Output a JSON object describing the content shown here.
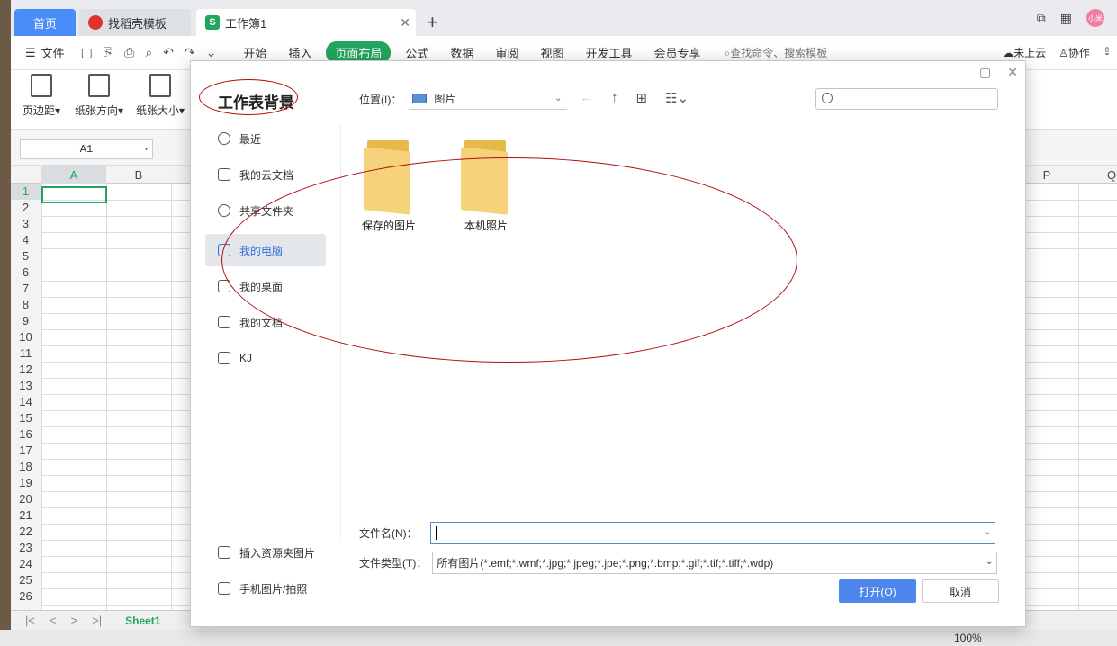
{
  "titlebar": {
    "tab_home": "首页",
    "tab_templates": "找稻壳模板",
    "tab_workbook": "工作簿1",
    "avatar_text": "小米"
  },
  "menubar": {
    "file": "文件",
    "items": [
      "开始",
      "插入",
      "页面布局",
      "公式",
      "数据",
      "审阅",
      "视图",
      "开发工具",
      "会员专享"
    ],
    "search": "查找命令、搜索模板",
    "cloud": "未上云",
    "collab": "协作"
  },
  "ribbon": {
    "margins": "页边距",
    "orientation": "纸张方向",
    "size": "纸张大小"
  },
  "formula": {
    "cell_ref": "A1"
  },
  "sheet": {
    "columns": [
      "A",
      "B",
      "P",
      "Q"
    ],
    "rows": [
      "1",
      "2",
      "3",
      "4",
      "5",
      "6",
      "7",
      "8",
      "9",
      "10",
      "11",
      "12",
      "13",
      "14",
      "15",
      "16",
      "17",
      "18",
      "19",
      "20",
      "21",
      "22",
      "23",
      "24",
      "25",
      "26"
    ],
    "sheet_tab": "Sheet1"
  },
  "status": {
    "zoom": "100%"
  },
  "dialog": {
    "title": "工作表背景",
    "nav": [
      "最近",
      "我的云文档",
      "共享文件夹",
      "我的电脑",
      "我的桌面",
      "我的文档",
      "KJ"
    ],
    "nav_bottom": [
      "插入资源夹图片",
      "手机图片/拍照"
    ],
    "location_label": "位置(I)：",
    "location_value": "图片",
    "folders": [
      "保存的图片",
      "本机照片"
    ],
    "filename_label": "文件名(N)：",
    "filename_value": "",
    "filetype_label": "文件类型(T)：",
    "filetype_value": "所有图片(*.emf;*.wmf;*.jpg;*.jpeg;*.jpe;*.png;*.bmp;*.gif;*.tif;*.tiff;*.wdp)",
    "open_button": "打开(O)",
    "cancel_button": "取消"
  },
  "colors": {
    "accent_green": "#22a55c",
    "home_tab_blue": "#4b8df8",
    "open_button_blue": "#4f86ec",
    "annotation_red": "#b01010"
  }
}
